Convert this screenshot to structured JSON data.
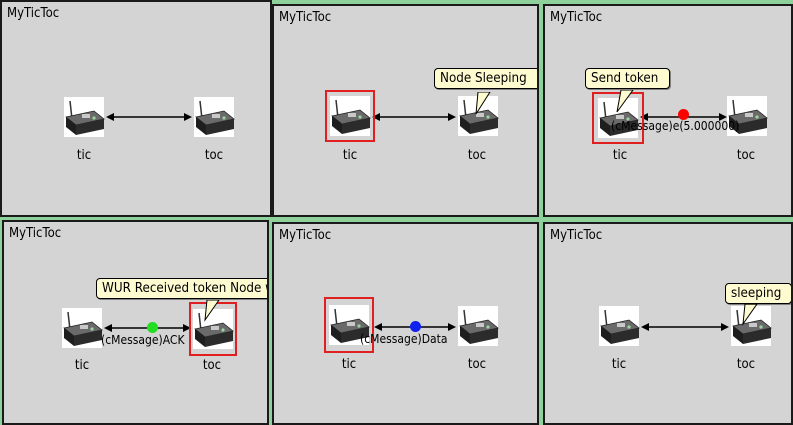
{
  "colors": {
    "background": "#8fd19a",
    "panel": "#d4d4d4",
    "selected_border": "#e02020",
    "bubble": "#fffbd0",
    "msg_red": "#ff0000",
    "msg_green": "#22dd22",
    "msg_blue": "#1020ee"
  },
  "panels": [
    {
      "title": "MyTicToc",
      "tic_label": "tic",
      "toc_label": "toc"
    },
    {
      "title": "MyTicToc",
      "tic_label": "tic",
      "toc_label": "toc",
      "bubble": "Node Sleeping"
    },
    {
      "title": "MyTicToc",
      "tic_label": "tic",
      "toc_label": "toc",
      "bubble": "Send token",
      "message": "(cMessage)e(5.000000)"
    },
    {
      "title": "MyTicToc",
      "tic_label": "tic",
      "toc_label": "toc",
      "bubble": "WUR Received token Node wakes up",
      "message": "(cMessage)ACK"
    },
    {
      "title": "MyTicToc",
      "tic_label": "tic",
      "toc_label": "toc",
      "message": "(cMessage)Data"
    },
    {
      "title": "MyTicToc",
      "tic_label": "tic",
      "toc_label": "toc",
      "bubble": "sleeping"
    }
  ],
  "icons": {
    "device": "sensor-node-icon"
  }
}
